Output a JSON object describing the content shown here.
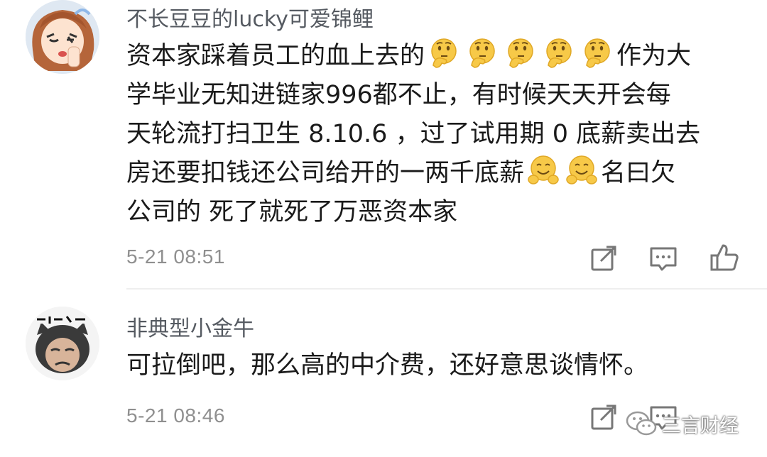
{
  "comments": [
    {
      "username": "不长豆豆的lucky可爱锦鲤",
      "lines": [
        {
          "a": "资本家踩着员工的血上去的",
          "b": "作为大"
        },
        {
          "a": "学毕业无知进链家996都不止，有时候天天开会每"
        },
        {
          "a": "天轮流打扫卫生 8.10.6 ，过了试用期 0 底薪卖出去"
        },
        {
          "a": "房还要扣钱还公司给开的一两千底薪",
          "b": "名曰欠"
        },
        {
          "a": "公司的 死了就死了万恶资本家"
        }
      ],
      "emojis_line1": [
        "thinking-emoji",
        "thinking-emoji",
        "thinking-emoji",
        "thinking-emoji",
        "thinking-emoji"
      ],
      "emojis_line4": [
        "hug-emoji",
        "hug-emoji"
      ],
      "time": "5-21 08:51"
    },
    {
      "username": "非典型小金牛",
      "lines": [
        {
          "a": "可拉倒吧，那么高的中介费，还好意思谈情怀。"
        }
      ],
      "time": "5-21 08:46"
    }
  ],
  "watermark": {
    "text": "三言财经"
  },
  "icons": {
    "share": "share-icon",
    "reply": "comment-icon",
    "like": "thumbs-up-icon"
  },
  "colors": {
    "username": "#555a61",
    "text": "#1a1a1a",
    "time": "#8f8f8f",
    "icon": "#777777",
    "emoji": "#f7c948"
  }
}
